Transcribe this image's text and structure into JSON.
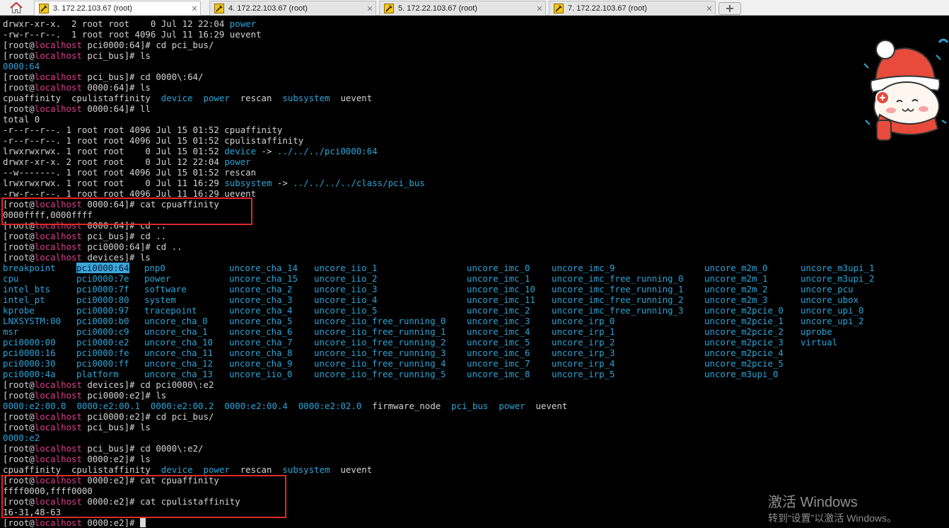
{
  "tabs": [
    {
      "label": "3. 172.22.103.67 (root)",
      "active": true
    },
    {
      "label": "4. 172.22.103.67 (root)",
      "active": false
    },
    {
      "label": "5. 172.22.103.67 (root)",
      "active": false
    },
    {
      "label": "7. 172.22.103.67 (root)",
      "active": false
    }
  ],
  "terminal": {
    "lines": [
      [
        [
          "drwxr-xr-x.  2 root root    0 Jul 12 22:04 ",
          "u"
        ],
        [
          "power",
          "b"
        ]
      ],
      [
        [
          "-rw-r--r--.  1 root root 4096 Jul 11 16:29 uevent",
          "u"
        ]
      ],
      [
        [
          "[root@",
          "u"
        ],
        [
          "localhost",
          "h"
        ],
        [
          " pci0000:64]# cd pci_bus/",
          "u"
        ]
      ],
      [
        [
          "[root@",
          "u"
        ],
        [
          "localhost",
          "h"
        ],
        [
          " pci_bus]# ls",
          "u"
        ]
      ],
      [
        [
          "0000:64",
          "b"
        ]
      ],
      [
        [
          "[root@",
          "u"
        ],
        [
          "localhost",
          "h"
        ],
        [
          " pci_bus]# cd 0000\\:64/",
          "u"
        ]
      ],
      [
        [
          "[root@",
          "u"
        ],
        [
          "localhost",
          "h"
        ],
        [
          " 0000:64]# ls",
          "u"
        ]
      ],
      [
        [
          "cpuaffinity  cpulistaffinity  ",
          "u"
        ],
        [
          "device",
          "b"
        ],
        [
          "  ",
          "u"
        ],
        [
          "power",
          "b"
        ],
        [
          "  rescan  ",
          "u"
        ],
        [
          "subsystem",
          "b"
        ],
        [
          "  uevent",
          "u"
        ]
      ],
      [
        [
          "[root@",
          "u"
        ],
        [
          "localhost",
          "h"
        ],
        [
          " 0000:64]# ll",
          "u"
        ]
      ],
      [
        [
          "total 0",
          "u"
        ]
      ],
      [
        [
          "-r--r--r--. 1 root root 4096 Jul 15 01:52 cpuaffinity",
          "u"
        ]
      ],
      [
        [
          "-r--r--r--. 1 root root 4096 Jul 15 01:52 cpulistaffinity",
          "u"
        ]
      ],
      [
        [
          "lrwxrwxrwx. 1 root root    0 Jul 15 01:52 ",
          "u"
        ],
        [
          "device",
          "b"
        ],
        [
          " -> ",
          "u"
        ],
        [
          "../../../pci0000:64",
          "b"
        ]
      ],
      [
        [
          "drwxr-xr-x. 2 root root    0 Jul 12 22:04 ",
          "u"
        ],
        [
          "power",
          "b"
        ]
      ],
      [
        [
          "--w-------. 1 root root 4096 Jul 15 01:52 rescan",
          "u"
        ]
      ],
      [
        [
          "lrwxrwxrwx. 1 root root    0 Jul 11 16:29 ",
          "u"
        ],
        [
          "subsystem",
          "b"
        ],
        [
          " -> ",
          "u"
        ],
        [
          "../../../../class/pci_bus",
          "b"
        ]
      ],
      [
        [
          "-rw-r--r--. 1 root root 4096 Jul 11 16:29 uevent",
          "u"
        ]
      ],
      [
        [
          "[root@",
          "u"
        ],
        [
          "localhost",
          "h"
        ],
        [
          " 0000:64]# cat cpuaffinity",
          "u"
        ]
      ],
      [
        [
          "0000ffff,0000ffff",
          "u"
        ]
      ],
      [
        [
          "[root@",
          "u"
        ],
        [
          "localhost",
          "h"
        ],
        [
          " 0000:64]# cd ..",
          "u"
        ]
      ],
      [
        [
          "[root@",
          "u"
        ],
        [
          "localhost",
          "h"
        ],
        [
          " pci_bus]# cd ..",
          "u"
        ]
      ],
      [
        [
          "[root@",
          "u"
        ],
        [
          "localhost",
          "h"
        ],
        [
          " pci0000:64]# cd ..",
          "u"
        ]
      ],
      [
        [
          "[root@",
          "u"
        ],
        [
          "localhost",
          "h"
        ],
        [
          " devices]# ls",
          "u"
        ]
      ],
      {
        "cols": [
          [
            "breakpoint",
            "b"
          ],
          [
            "pci0000:64",
            "s"
          ],
          [
            "pnp0",
            "b"
          ],
          [
            "uncore_cha_14",
            "b"
          ],
          [
            "uncore_iio_1",
            "b"
          ],
          [
            "uncore_imc_0",
            "b"
          ],
          [
            "uncore_imc_9",
            "b"
          ],
          [
            "uncore_m2m_0",
            "b"
          ],
          [
            "uncore_m3upi_1",
            "b"
          ]
        ]
      },
      {
        "cols": [
          [
            "cpu",
            "b"
          ],
          [
            "pci0000:7e",
            "b"
          ],
          [
            "power",
            "b"
          ],
          [
            "uncore_cha_15",
            "b"
          ],
          [
            "uncore_iio_2",
            "b"
          ],
          [
            "uncore_imc_1",
            "b"
          ],
          [
            "uncore_imc_free_running_0",
            "b"
          ],
          [
            "uncore_m2m_1",
            "b"
          ],
          [
            "uncore_m3upi_2",
            "b"
          ]
        ]
      },
      {
        "cols": [
          [
            "intel_bts",
            "b"
          ],
          [
            "pci0000:7f",
            "b"
          ],
          [
            "software",
            "b"
          ],
          [
            "uncore_cha_2",
            "b"
          ],
          [
            "uncore_iio_3",
            "b"
          ],
          [
            "uncore_imc_10",
            "b"
          ],
          [
            "uncore_imc_free_running_1",
            "b"
          ],
          [
            "uncore_m2m_2",
            "b"
          ],
          [
            "uncore_pcu",
            "b"
          ]
        ]
      },
      {
        "cols": [
          [
            "intel_pt",
            "b"
          ],
          [
            "pci0000:80",
            "b"
          ],
          [
            "system",
            "b"
          ],
          [
            "uncore_cha_3",
            "b"
          ],
          [
            "uncore_iio_4",
            "b"
          ],
          [
            "uncore_imc_11",
            "b"
          ],
          [
            "uncore_imc_free_running_2",
            "b"
          ],
          [
            "uncore_m2m_3",
            "b"
          ],
          [
            "uncore_ubox",
            "b"
          ]
        ]
      },
      {
        "cols": [
          [
            "kprobe",
            "b"
          ],
          [
            "pci0000:97",
            "b"
          ],
          [
            "tracepoint",
            "b"
          ],
          [
            "uncore_cha_4",
            "b"
          ],
          [
            "uncore_iio_5",
            "b"
          ],
          [
            "uncore_imc_2",
            "b"
          ],
          [
            "uncore_imc_free_running_3",
            "b"
          ],
          [
            "uncore_m2pcie_0",
            "b"
          ],
          [
            "uncore_upi_0",
            "b"
          ]
        ]
      },
      {
        "cols": [
          [
            "LNXSYSTM:00",
            "b"
          ],
          [
            "pci0000:b0",
            "b"
          ],
          [
            "uncore_cha_0",
            "b"
          ],
          [
            "uncore_cha_5",
            "b"
          ],
          [
            "uncore_iio_free_running_0",
            "b"
          ],
          [
            "uncore_imc_3",
            "b"
          ],
          [
            "uncore_irp_0",
            "b"
          ],
          [
            "uncore_m2pcie_1",
            "b"
          ],
          [
            "uncore_upi_2",
            "b"
          ]
        ]
      },
      {
        "cols": [
          [
            "msr",
            "b"
          ],
          [
            "pci0000:c9",
            "b"
          ],
          [
            "uncore_cha_1",
            "b"
          ],
          [
            "uncore_cha_6",
            "b"
          ],
          [
            "uncore_iio_free_running_1",
            "b"
          ],
          [
            "uncore_imc_4",
            "b"
          ],
          [
            "uncore_irp_1",
            "b"
          ],
          [
            "uncore_m2pcie_2",
            "b"
          ],
          [
            "uprobe",
            "b"
          ]
        ]
      },
      {
        "cols": [
          [
            "pci0000:00",
            "b"
          ],
          [
            "pci0000:e2",
            "b"
          ],
          [
            "uncore_cha_10",
            "b"
          ],
          [
            "uncore_cha_7",
            "b"
          ],
          [
            "uncore_iio_free_running_2",
            "b"
          ],
          [
            "uncore_imc_5",
            "b"
          ],
          [
            "uncore_irp_2",
            "b"
          ],
          [
            "uncore_m2pcie_3",
            "b"
          ],
          [
            "virtual",
            "b"
          ]
        ]
      },
      {
        "cols": [
          [
            "pci0000:16",
            "b"
          ],
          [
            "pci0000:fe",
            "b"
          ],
          [
            "uncore_cha_11",
            "b"
          ],
          [
            "uncore_cha_8",
            "b"
          ],
          [
            "uncore_iio_free_running_3",
            "b"
          ],
          [
            "uncore_imc_6",
            "b"
          ],
          [
            "uncore_irp_3",
            "b"
          ],
          [
            "uncore_m2pcie_4",
            "b"
          ],
          [
            "",
            "b"
          ]
        ]
      },
      {
        "cols": [
          [
            "pci0000:30",
            "b"
          ],
          [
            "pci0000:ff",
            "b"
          ],
          [
            "uncore_cha_12",
            "b"
          ],
          [
            "uncore_cha_9",
            "b"
          ],
          [
            "uncore_iio_free_running_4",
            "b"
          ],
          [
            "uncore_imc_7",
            "b"
          ],
          [
            "uncore_irp_4",
            "b"
          ],
          [
            "uncore_m2pcie_5",
            "b"
          ],
          [
            "",
            "b"
          ]
        ]
      },
      {
        "cols": [
          [
            "pci0000:4a",
            "b"
          ],
          [
            "platform",
            "b"
          ],
          [
            "uncore_cha_13",
            "b"
          ],
          [
            "uncore_iio_0",
            "b"
          ],
          [
            "uncore_iio_free_running_5",
            "b"
          ],
          [
            "uncore_imc_8",
            "b"
          ],
          [
            "uncore_irp_5",
            "b"
          ],
          [
            "uncore_m3upi_0",
            "b"
          ],
          [
            "",
            "b"
          ]
        ]
      },
      [
        [
          "[root@",
          "u"
        ],
        [
          "localhost",
          "h"
        ],
        [
          " devices]# cd pci0000\\:e2",
          "u"
        ]
      ],
      [
        [
          "[root@",
          "u"
        ],
        [
          "localhost",
          "h"
        ],
        [
          " pci0000:e2]# ls",
          "u"
        ]
      ],
      [
        [
          "0000:e2:00.0",
          "b"
        ],
        [
          "  ",
          "u"
        ],
        [
          "0000:e2:00.1",
          "b"
        ],
        [
          "  ",
          "u"
        ],
        [
          "0000:e2:00.2",
          "b"
        ],
        [
          "  ",
          "u"
        ],
        [
          "0000:e2:00.4",
          "b"
        ],
        [
          "  ",
          "u"
        ],
        [
          "0000:e2:02.0",
          "b"
        ],
        [
          "  firmware_node  ",
          "u"
        ],
        [
          "pci_bus",
          "b"
        ],
        [
          "  ",
          "u"
        ],
        [
          "power",
          "b"
        ],
        [
          "  uevent",
          "u"
        ]
      ],
      [
        [
          "[root@",
          "u"
        ],
        [
          "localhost",
          "h"
        ],
        [
          " pci0000:e2]# cd pci_bus/",
          "u"
        ]
      ],
      [
        [
          "[root@",
          "u"
        ],
        [
          "localhost",
          "h"
        ],
        [
          " pci_bus]# ls",
          "u"
        ]
      ],
      [
        [
          "0000:e2",
          "b"
        ]
      ],
      [
        [
          "[root@",
          "u"
        ],
        [
          "localhost",
          "h"
        ],
        [
          " pci_bus]# cd 0000\\:e2/",
          "u"
        ]
      ],
      [
        [
          "[root@",
          "u"
        ],
        [
          "localhost",
          "h"
        ],
        [
          " 0000:e2]# ls",
          "u"
        ]
      ],
      [
        [
          "cpuaffinity  cpulistaffinity  ",
          "u"
        ],
        [
          "device",
          "b"
        ],
        [
          "  ",
          "u"
        ],
        [
          "power",
          "b"
        ],
        [
          "  rescan  ",
          "u"
        ],
        [
          "subsystem",
          "b"
        ],
        [
          "  uevent",
          "u"
        ]
      ],
      [
        [
          "[root@",
          "u"
        ],
        [
          "localhost",
          "h"
        ],
        [
          " 0000:e2]# cat cpuaffinity",
          "u"
        ]
      ],
      [
        [
          "ffff0000,ffff0000",
          "u"
        ]
      ],
      [
        [
          "[root@",
          "u"
        ],
        [
          "localhost",
          "h"
        ],
        [
          " 0000:e2]# cat cpulistaffinity",
          "u"
        ]
      ],
      [
        [
          "16-31,48-63",
          "u"
        ]
      ],
      [
        [
          "[root@",
          "u"
        ],
        [
          "localhost",
          "h"
        ],
        [
          " 0000:e2]# ",
          "u"
        ]
      ]
    ]
  },
  "watermark": {
    "line1": "激活 Windows",
    "line2": "转到“设置”以激活 Windows。"
  },
  "colors": {
    "hostname": "#e23d8f",
    "dir": "#2aa5d8",
    "highlight_box": "#e02828"
  },
  "sticker": {
    "icon": "cartoon-bun-with-winter-hat-sticker"
  }
}
